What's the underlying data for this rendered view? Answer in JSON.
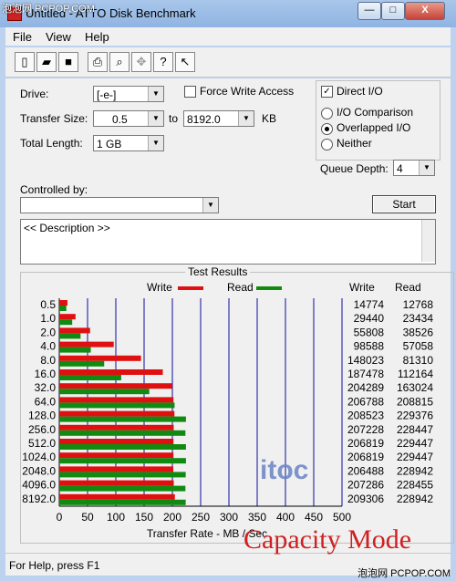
{
  "window": {
    "title": "Untitled - ATTO Disk Benchmark",
    "watermark_top": "泡泡网 PCPOP.COM"
  },
  "title_buttons": {
    "minimize": "—",
    "maximize": "□",
    "close": "X"
  },
  "menu": [
    "File",
    "View",
    "Help"
  ],
  "toolbar_icons": [
    "new-icon",
    "open-icon",
    "save-icon",
    "print-icon",
    "print-preview-icon",
    "move-icon",
    "help-icon",
    "context-help-icon"
  ],
  "form": {
    "drive_label": "Drive:",
    "drive_value": "[-e-]",
    "force_write_label": "Force Write Access",
    "force_write_checked": false,
    "direct_io_label": "Direct I/O",
    "direct_io_checked": true,
    "transfer_size_label": "Transfer Size:",
    "transfer_from": "0.5",
    "to_label": "to",
    "transfer_to": "8192.0",
    "kb_label": "KB",
    "io_comparison_label": "I/O Comparison",
    "overlapped_io_label": "Overlapped I/O",
    "neither_label": "Neither",
    "selected_io_mode": "Overlapped I/O",
    "total_length_label": "Total Length:",
    "total_length_value": "1 GB",
    "queue_depth_label": "Queue Depth:",
    "queue_depth_value": "4",
    "controlled_by_label": "Controlled by:",
    "controlled_by_value": "",
    "start_label": "Start",
    "description": "<< Description >>"
  },
  "results": {
    "title": "Test Results",
    "write_header": "Write",
    "read_header": "Read",
    "write_color": "#e01010",
    "read_color": "#108a10",
    "grid_color": "#3333aa"
  },
  "chart_data": {
    "type": "bar",
    "orientation": "horizontal",
    "categories": [
      "0.5",
      "1.0",
      "2.0",
      "4.0",
      "8.0",
      "16.0",
      "32.0",
      "64.0",
      "128.0",
      "256.0",
      "512.0",
      "1024.0",
      "2048.0",
      "4096.0",
      "8192.0"
    ],
    "series": [
      {
        "name": "Write",
        "values": [
          14774,
          29440,
          55808,
          98588,
          148023,
          187478,
          204289,
          206788,
          208523,
          207228,
          206819,
          206819,
          206488,
          207286,
          209306
        ]
      },
      {
        "name": "Read",
        "values": [
          12768,
          23434,
          38526,
          57058,
          81310,
          112164,
          163024,
          208815,
          229376,
          228447,
          229447,
          229447,
          228942,
          228455,
          228942
        ]
      }
    ],
    "write_values_text": [
      "14774",
      "29440",
      "55808",
      "98588",
      "148023",
      "187478",
      "204289",
      "206788",
      "208523",
      "207228",
      "206819",
      "206819",
      "206488",
      "207286",
      "209306"
    ],
    "read_values_text": [
      "12768",
      "23434",
      "38526",
      "57058",
      "81310",
      "112164",
      "163024",
      "208815",
      "229376",
      "228447",
      "229447",
      "229447",
      "228942",
      "228455",
      "228942"
    ],
    "xlabel": "Transfer Rate - MB / Sec",
    "xticks": [
      "0",
      "50",
      "100",
      "150",
      "200",
      "250",
      "300",
      "350",
      "400",
      "450",
      "500"
    ],
    "xlim": [
      0,
      500
    ],
    "legend": [
      "Write",
      "Read"
    ],
    "legend_position": "top"
  },
  "overlay": {
    "mode_text": "Capacity Mode",
    "chart_logo": "itoc"
  },
  "status": {
    "text": "For Help, press F1",
    "watermark": "泡泡网 PCPOP.COM"
  }
}
